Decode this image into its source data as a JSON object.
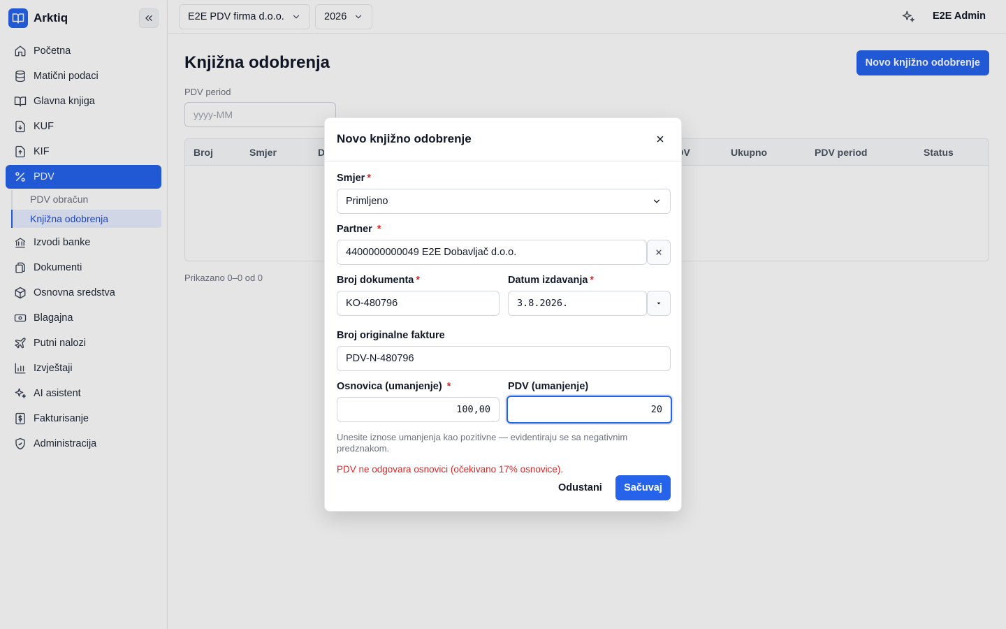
{
  "app": {
    "name": "Arktiq"
  },
  "sidebar": {
    "items": [
      {
        "label": "Početna",
        "icon": "home-icon"
      },
      {
        "label": "Matični podaci",
        "icon": "database-icon"
      },
      {
        "label": "Glavna knjiga",
        "icon": "book-icon"
      },
      {
        "label": "KUF",
        "icon": "file-import-icon"
      },
      {
        "label": "KIF",
        "icon": "file-export-icon"
      },
      {
        "label": "PDV",
        "icon": "percent-icon",
        "active": true
      },
      {
        "label": "Izvodi banke",
        "icon": "bank-icon"
      },
      {
        "label": "Dokumenti",
        "icon": "documents-icon"
      },
      {
        "label": "Osnovna sredstva",
        "icon": "box-icon"
      },
      {
        "label": "Blagajna",
        "icon": "cash-icon"
      },
      {
        "label": "Putni nalozi",
        "icon": "plane-icon"
      },
      {
        "label": "Izvještaji",
        "icon": "chart-icon"
      },
      {
        "label": "AI asistent",
        "icon": "sparkles-icon"
      },
      {
        "label": "Fakturisanje",
        "icon": "invoice-dollar-icon"
      },
      {
        "label": "Administracija",
        "icon": "shield-icon"
      }
    ],
    "pdv_sub": [
      {
        "label": "PDV obračun"
      },
      {
        "label": "Knjižna odobrenja",
        "active": true
      }
    ]
  },
  "topbar": {
    "company": "E2E PDV firma d.o.o.",
    "year": "2026",
    "user": "E2E Admin"
  },
  "page": {
    "title": "Knjižna odobrenja",
    "new_button": "Novo knjižno odobrenje",
    "filter_label": "PDV period",
    "filter_placeholder": "yyyy-MM",
    "columns": [
      "Broj",
      "Smjer",
      "D",
      "PDV",
      "Ukupno",
      "PDV period",
      "Status"
    ],
    "summary": "Prikazano 0–0 od 0"
  },
  "modal": {
    "title": "Novo knjižno odobrenje",
    "smjer_label": "Smjer",
    "smjer_value": "Primljeno",
    "partner_label": "Partner",
    "partner_value": "4400000000049 E2E Dobavljač d.o.o.",
    "broj_label": "Broj dokumenta",
    "broj_value": "KO-480796",
    "datum_label": "Datum izdavanja",
    "datum_value": "3.8.2026.",
    "orig_label": "Broj originalne fakture",
    "orig_value": "PDV-N-480796",
    "osnovica_label": "Osnovica (umanjenje)",
    "osnovica_value": "100,00",
    "pdv_label": "PDV (umanjenje)",
    "pdv_value": "20",
    "required_mark": "*",
    "hint": "Unesite iznose umanjenja kao pozitivne — evidentiraju se sa negativnim predznakom.",
    "error": "PDV ne odgovara osnovici (očekivano 17% osnovice).",
    "cancel": "Odustani",
    "save": "Sačuvaj"
  },
  "colors": {
    "accent": "#2563eb",
    "error": "#dc2626"
  }
}
